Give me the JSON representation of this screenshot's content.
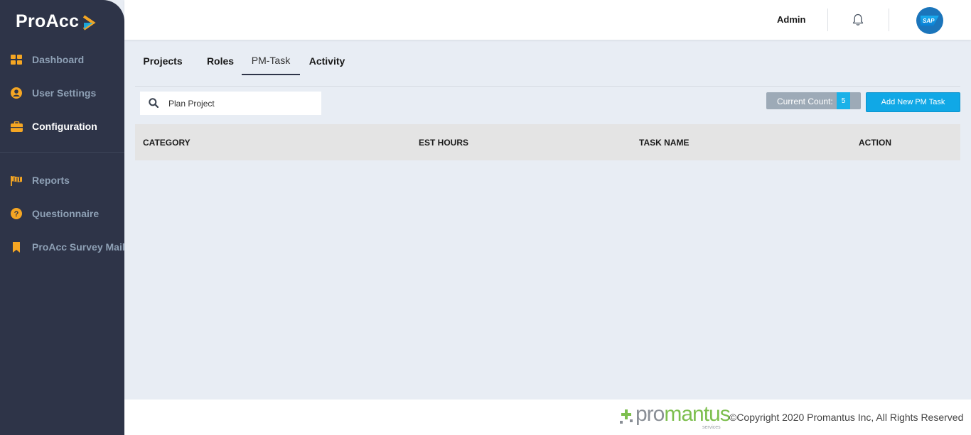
{
  "app": {
    "logo_text": "ProAcc",
    "brand_accent": "#f5a623"
  },
  "sidebar": {
    "items": [
      {
        "label": "Dashboard",
        "icon": "grid-icon"
      },
      {
        "label": "User Settings",
        "icon": "user-circle-icon"
      },
      {
        "label": "Configuration",
        "icon": "briefcase-icon",
        "active": true
      },
      {
        "label": "Reports",
        "icon": "flag-icon"
      },
      {
        "label": "Questionnaire",
        "icon": "question-circle-icon"
      },
      {
        "label": "ProAcc Survey Mail",
        "icon": "bookmark-icon"
      }
    ]
  },
  "header": {
    "user_label": "Admin",
    "bell_icon": "bell-icon",
    "avatar_text": "SAP"
  },
  "tabs": [
    {
      "label": "Projects"
    },
    {
      "label": "Roles"
    },
    {
      "label": "PM-Task",
      "active": true
    },
    {
      "label": "Activity"
    }
  ],
  "search": {
    "value": "Plan Project",
    "placeholder": "Plan Project"
  },
  "count": {
    "label": "Current Count:",
    "value": "5"
  },
  "actions": {
    "add_label": "Add New PM Task"
  },
  "table": {
    "columns": [
      "CATEGORY",
      "EST HOURS",
      "TASK NAME",
      "ACTION"
    ],
    "rows": []
  },
  "footer": {
    "brand_pro": "pro",
    "brand_rest": "mantus",
    "brand_sub": "services",
    "copyright": "©Copyright 2020 Promantus Inc, All Rights Reserved"
  }
}
